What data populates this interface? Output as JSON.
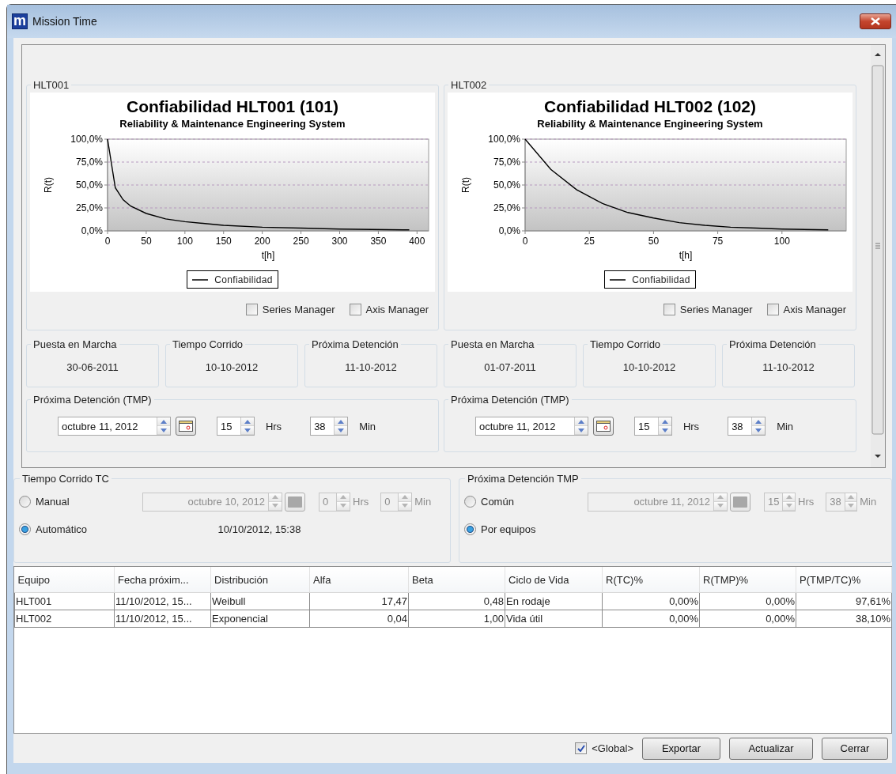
{
  "window": {
    "title": "Mission Time",
    "icon_text": "m"
  },
  "equipment_panels": [
    {
      "group_label": "HLT001",
      "chart": {
        "subtitle": "Reliability & Maintenance Engineering System",
        "chart_data": {
          "type": "line",
          "title": "Confiabilidad HLT001 (101)",
          "xlabel": "t[h]",
          "ylabel": "R(t)",
          "x": [
            0,
            10,
            20,
            30,
            50,
            75,
            100,
            150,
            200,
            250,
            300,
            390
          ],
          "series": [
            {
              "name": "Confiabilidad",
              "color": "#000000",
              "values": [
                100,
                47,
                34,
                27,
                19,
                13,
                10,
                6,
                4,
                3,
                2,
                1
              ]
            }
          ],
          "grid": true,
          "xlim": [
            0,
            415
          ],
          "ylim": [
            0,
            100
          ],
          "xticks": [
            0,
            50,
            100,
            150,
            200,
            250,
            300,
            350,
            400
          ],
          "yticks": [
            {
              "value": 0,
              "label": "0,0%"
            },
            {
              "value": 25,
              "label": "25,0%"
            },
            {
              "value": 50,
              "label": "50,0%"
            },
            {
              "value": 75,
              "label": "75,0%"
            },
            {
              "value": 100,
              "label": "100,0%"
            }
          ]
        }
      },
      "managers": [
        {
          "label": "Series Manager",
          "checked": false
        },
        {
          "label": "Axis Manager",
          "checked": false
        }
      ],
      "info": [
        {
          "label": "Puesta en Marcha",
          "value": "30-06-2011"
        },
        {
          "label": "Tiempo Corrido",
          "value": "10-10-2012"
        },
        {
          "label": "Próxima Detención",
          "value": "11-10-2012"
        }
      ],
      "tmp": {
        "label": "Próxima Detención (TMP)",
        "date": "octubre 11, 2012",
        "hours": "15",
        "hours_unit": "Hrs",
        "minutes": "38",
        "minutes_unit": "Min"
      }
    },
    {
      "group_label": "HLT002",
      "chart": {
        "subtitle": "Reliability & Maintenance Engineering System",
        "chart_data": {
          "type": "line",
          "title": "Confiabilidad HLT002 (102)",
          "xlabel": "t[h]",
          "ylabel": "R(t)",
          "x": [
            0,
            10,
            20,
            30,
            40,
            50,
            60,
            70,
            80,
            90,
            100,
            118
          ],
          "series": [
            {
              "name": "Confiabilidad",
              "color": "#000000",
              "values": [
                100,
                67,
                45,
                30,
                20,
                14,
                9,
                6,
                4,
                3,
                2,
                1
              ]
            }
          ],
          "grid": true,
          "xlim": [
            0,
            125
          ],
          "ylim": [
            0,
            100
          ],
          "xticks": [
            0,
            25,
            50,
            75,
            100
          ],
          "yticks": [
            {
              "value": 0,
              "label": "0,0%"
            },
            {
              "value": 25,
              "label": "25,0%"
            },
            {
              "value": 50,
              "label": "50,0%"
            },
            {
              "value": 75,
              "label": "75,0%"
            },
            {
              "value": 100,
              "label": "100,0%"
            }
          ]
        }
      },
      "managers": [
        {
          "label": "Series Manager",
          "checked": false
        },
        {
          "label": "Axis Manager",
          "checked": false
        }
      ],
      "info": [
        {
          "label": "Puesta en Marcha",
          "value": "01-07-2011"
        },
        {
          "label": "Tiempo Corrido",
          "value": "10-10-2012"
        },
        {
          "label": "Próxima Detención",
          "value": "11-10-2012"
        }
      ],
      "tmp": {
        "label": "Próxima Detención (TMP)",
        "date": "octubre 11, 2012",
        "hours": "15",
        "hours_unit": "Hrs",
        "minutes": "38",
        "minutes_unit": "Min"
      }
    }
  ],
  "tiempo_corrido": {
    "label": "Tiempo Corrido TC",
    "options": [
      {
        "label": "Manual",
        "selected": false
      },
      {
        "label": "Automático",
        "selected": true
      }
    ],
    "disabled": true,
    "date": "octubre 10, 2012",
    "hours": "0",
    "hours_unit": "Hrs",
    "minutes": "0",
    "minutes_unit": "Min",
    "current": "10/10/2012, 15:38"
  },
  "proxima_tmp": {
    "label": "Próxima Detención TMP",
    "options": [
      {
        "label": "Común",
        "selected": false
      },
      {
        "label": "Por equipos",
        "selected": true
      }
    ],
    "disabled": true,
    "date": "octubre 11, 2012",
    "hours": "15",
    "hours_unit": "Hrs",
    "minutes": "38",
    "minutes_unit": "Min"
  },
  "table": {
    "columns": [
      {
        "label": "Equipo",
        "kind": "text"
      },
      {
        "label": "Fecha próxim...",
        "kind": "text"
      },
      {
        "label": "Distribución",
        "kind": "text"
      },
      {
        "label": "Alfa",
        "kind": "number"
      },
      {
        "label": "Beta",
        "kind": "number"
      },
      {
        "label": "Ciclo de Vida",
        "kind": "text"
      },
      {
        "label": "R(TC)%",
        "kind": "number"
      },
      {
        "label": "R(TMP)%",
        "kind": "number"
      },
      {
        "label": "P(TMP/TC)%",
        "kind": "number"
      }
    ],
    "rows": [
      {
        "cells": [
          "HLT001",
          "11/10/2012, 15...",
          "Weibull",
          "17,47",
          "0,48",
          "En rodaje",
          "0,00%",
          "0,00%",
          "97,61%"
        ]
      },
      {
        "cells": [
          "HLT002",
          "11/10/2012, 15...",
          "Exponencial",
          "0,04",
          "1,00",
          "Vida útil",
          "0,00%",
          "0,00%",
          "38,10%"
        ]
      }
    ]
  },
  "footer": {
    "global": {
      "label": "<Global>",
      "checked": true
    },
    "buttons": [
      "Exportar",
      "Actualizar",
      "Cerrar"
    ]
  }
}
